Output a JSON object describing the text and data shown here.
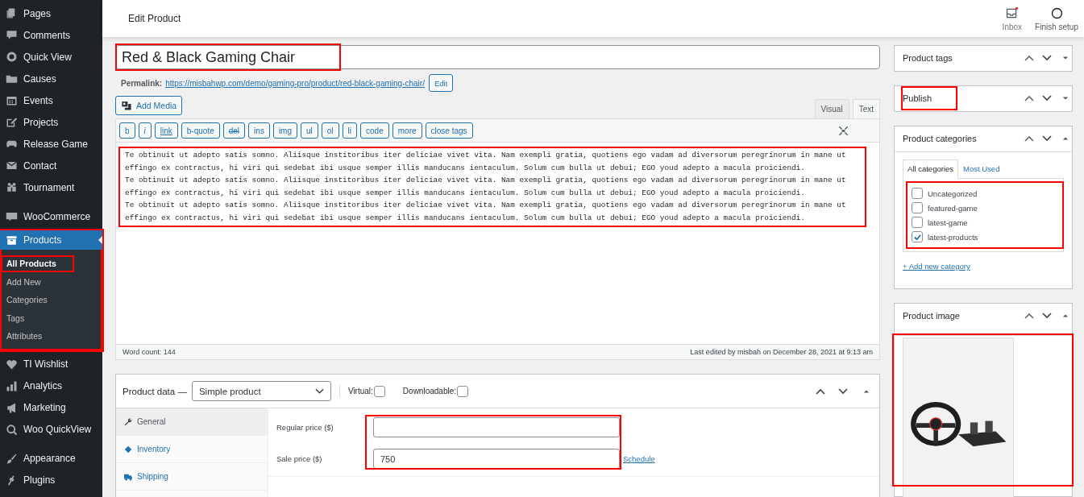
{
  "header": {
    "title": "Edit Product",
    "actions": [
      {
        "label": "Inbox",
        "unread": true
      },
      {
        "label": "Finish setup",
        "unread": false
      }
    ]
  },
  "sidebar": {
    "items": [
      {
        "label": "Pages",
        "selected": false,
        "separator_before": false
      },
      {
        "label": "Comments",
        "selected": false,
        "separator_before": false
      },
      {
        "label": "Quick View",
        "selected": false,
        "separator_before": false
      },
      {
        "label": "Causes",
        "selected": false,
        "separator_before": false
      },
      {
        "label": "Events",
        "selected": false,
        "separator_before": false
      },
      {
        "label": "Projects",
        "selected": false,
        "separator_before": false
      },
      {
        "label": "Release Game",
        "selected": false,
        "separator_before": false
      },
      {
        "label": "Contact",
        "selected": false,
        "separator_before": false
      },
      {
        "label": "Tournament",
        "selected": false,
        "separator_before": false
      },
      {
        "label": "WooCommerce",
        "selected": false,
        "separator_before": true
      },
      {
        "label": "Products",
        "selected": true,
        "separator_before": false,
        "highlighted": true,
        "children": [
          {
            "label": "All Products",
            "selected": true,
            "highlighted": true
          },
          {
            "label": "Add New",
            "selected": false,
            "highlighted": false
          },
          {
            "label": "Categories",
            "selected": false,
            "highlighted": false
          },
          {
            "label": "Tags",
            "selected": false,
            "highlighted": false
          },
          {
            "label": "Attributes",
            "selected": false,
            "highlighted": false
          }
        ]
      },
      {
        "label": "TI Wishlist",
        "selected": false,
        "separator_before": false
      },
      {
        "label": "Analytics",
        "selected": false,
        "separator_before": false
      },
      {
        "label": "Marketing",
        "selected": false,
        "separator_before": false
      },
      {
        "label": "Woo QuickView",
        "selected": false,
        "separator_before": false
      },
      {
        "label": "Appearance",
        "selected": false,
        "separator_before": true
      },
      {
        "label": "Plugins",
        "selected": false,
        "separator_before": false
      }
    ]
  },
  "editor": {
    "title": {
      "value": "Red & Black Gaming Chair",
      "highlighted": true
    },
    "permalink": {
      "label": "Permalink:",
      "url": "https://misbahwp.com/demo/gaming-pro/product/red-black-gaming-chair/",
      "button": "Edit"
    },
    "add_media": "Add Media",
    "tabs": [
      {
        "label": "Visual",
        "selected": false
      },
      {
        "label": "Text",
        "selected": true
      }
    ],
    "toolbar": [
      {
        "label": "b",
        "kind": "plain"
      },
      {
        "label": "i",
        "kind": "italic"
      },
      {
        "label": "link",
        "kind": "underline"
      },
      {
        "label": "b-quote",
        "kind": "plain"
      },
      {
        "label": "del",
        "kind": "strike"
      },
      {
        "label": "ins",
        "kind": "plain"
      },
      {
        "label": "img",
        "kind": "plain"
      },
      {
        "label": "ul",
        "kind": "plain"
      },
      {
        "label": "ol",
        "kind": "plain"
      },
      {
        "label": "li",
        "kind": "plain"
      },
      {
        "label": "code",
        "kind": "plain"
      },
      {
        "label": "more",
        "kind": "plain"
      },
      {
        "label": "close tags",
        "kind": "plain"
      }
    ],
    "content": {
      "highlighted": true,
      "paragraphs": [
        "Te obtinuit ut adepto satis somno. Aliisque institoribus iter deliciae vivet vita. Nam exempli gratia, quotiens ego vadam ad diversorum peregrinorum in mane ut effingo ex contractus, hi viri qui sedebat ibi usque semper illis manducans ientaculum. Solum cum bulla ut debui; EGO youd adepto a macula proiciendi.",
        "Te obtinuit ut adepto satis somno. Aliisque institoribus iter deliciae vivet vita. Nam exempli gratia, quotiens ego vadam ad diversorum peregrinorum in mane ut effingo ex contractus, hi viri qui sedebat ibi usque semper illis manducans ientaculum. Solum cum bulla ut debui; EGO youd adepto a macula proiciendi.",
        "Te obtinuit ut adepto satis somno. Aliisque institoribus iter deliciae vivet vita. Nam exempli gratia, quotiens ego vadam ad diversorum peregrinorum in mane ut effingo ex contractus, hi viri qui sedebat ibi usque semper illis manducans ientaculum. Solum cum bulla ut debui; EGO youd adepto a macula proiciendi."
      ]
    },
    "word_count": "Word count: 144",
    "last_edited": "Last edited by misbah on December 28, 2021 at 9:13 am"
  },
  "product_data": {
    "label": "Product data —",
    "type": "Simple product",
    "options": [
      {
        "label": "Virtual:",
        "checked": false
      },
      {
        "label": "Downloadable:",
        "checked": false
      }
    ],
    "tabs": [
      {
        "label": "General",
        "selected": true
      },
      {
        "label": "Inventory",
        "selected": false
      },
      {
        "label": "Shipping",
        "selected": false
      }
    ],
    "fields_highlighted": true,
    "fields": [
      {
        "label": "Regular price ($)"
      },
      {
        "label": "Sale price ($)",
        "value": "750",
        "link": "Schedule"
      }
    ]
  },
  "side_boxes": [
    {
      "kind": "tags",
      "title": "Product tags",
      "expanded": false,
      "highlighted": false
    },
    {
      "kind": "publish",
      "title": "Publish",
      "expanded": false,
      "highlighted": true
    },
    {
      "kind": "categories",
      "title": "Product categories",
      "expanded": true,
      "highlighted": false,
      "tabs": [
        {
          "label": "All categories",
          "selected": true
        },
        {
          "label": "Most Used",
          "selected": false
        }
      ],
      "list_highlighted": true,
      "categories": [
        {
          "label": "Uncategorized",
          "checked": false
        },
        {
          "label": "featured-game",
          "checked": false
        },
        {
          "label": "latest-game",
          "checked": false
        },
        {
          "label": "latest-products",
          "checked": true
        }
      ],
      "add_link": "+ Add new category"
    },
    {
      "kind": "image",
      "title": "Product image",
      "expanded": true,
      "highlighted": false,
      "image_highlighted": true
    }
  ]
}
